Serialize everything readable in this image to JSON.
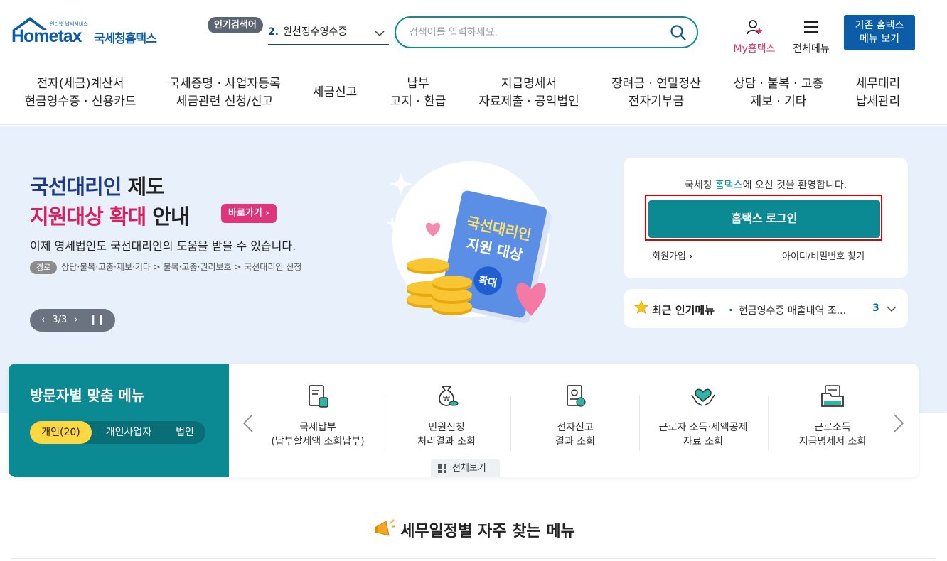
{
  "header": {
    "logo_small": "인터넷 납세서비스",
    "logo_word": "Hometax",
    "logo_kr": "국세청홈택스",
    "popular_badge": "인기검색어",
    "popular_rank": "2.",
    "popular_term": "원천징수영수증",
    "search_placeholder": "검색어를 입력하세요.",
    "my_hometax": "My홈택스",
    "all_menu": "전체메뉴",
    "old_hometax_line1": "기존 홈택스",
    "old_hometax_line2": "메뉴 보기"
  },
  "gnb": [
    {
      "line1": "전자(세금)계산서",
      "line2": "현금영수증 · 신용카드"
    },
    {
      "line1": "국세증명 · 사업자등록",
      "line2": "세금관련 신청/신고"
    },
    {
      "line1": "세금신고",
      "line2": ""
    },
    {
      "line1": "납부",
      "line2": "고지 · 환급"
    },
    {
      "line1": "지급명세서",
      "line2": "자료제출 · 공익법인"
    },
    {
      "line1": "장려금 · 연말정산",
      "line2": "전자기부금"
    },
    {
      "line1": "상담 · 불복 · 고충",
      "line2": "제보 · 기타"
    },
    {
      "line1": "세무대리",
      "line2": "납세관리"
    }
  ],
  "hero": {
    "title_part1": "국선대리인",
    "title_part2": " 제도",
    "title_part3": "지원대상 확대",
    "title_part4": " 안내",
    "shortcut": "바로가기",
    "description": "이제 영세법인도 국선대리인의 도움을 받을 수 있습니다.",
    "route_tag": "경로",
    "route": "상담·불복·고충·제보·기타 > 불복·고충·권리보호 > 국선대리인 신청",
    "pager": "3/3",
    "book_line1": "국선대리인",
    "book_line2": "지원 대상",
    "book_badge": "확대"
  },
  "login": {
    "welcome_pre": "국세청 ",
    "welcome_hl": "홈택스",
    "welcome_post": "에 오신 것을 환영합니다.",
    "login_button": "홈택스 로그인",
    "join": "회원가입",
    "find": "아이디/비밀번호 찾기"
  },
  "recent": {
    "title": "최근 인기메뉴",
    "item": "현금영수증 매출내역 조...",
    "rank": "3"
  },
  "visitor": {
    "title": "방문자별 맞춤 메뉴",
    "tabs": [
      "개인(20)",
      "개인사업자",
      "법인"
    ],
    "items": [
      {
        "line1": "국세납부",
        "line2": "(납부할세액 조회납부)",
        "icon": "tax-payment-icon"
      },
      {
        "line1": "민원신청",
        "line2": "처리결과 조회",
        "icon": "money-bag-icon"
      },
      {
        "line1": "전자신고",
        "line2": "결과 조회",
        "icon": "e-filing-icon"
      },
      {
        "line1": "근로자 소득·세액공제",
        "line2": "자료 조회",
        "icon": "heart-hands-icon"
      },
      {
        "line1": "근로소득",
        "line2": "지급명세서 조회",
        "icon": "folder-doc-icon"
      }
    ],
    "view_all": "전체보기"
  },
  "schedule": {
    "title": "세무일정별 자주 찾는 메뉴"
  },
  "colors": {
    "brand_blue": "#0d5ca8",
    "teal": "#0b8a94",
    "pink": "#d6235f",
    "hero_bg": "#e8f0fb",
    "highlight_yellow": "#ffd740"
  }
}
